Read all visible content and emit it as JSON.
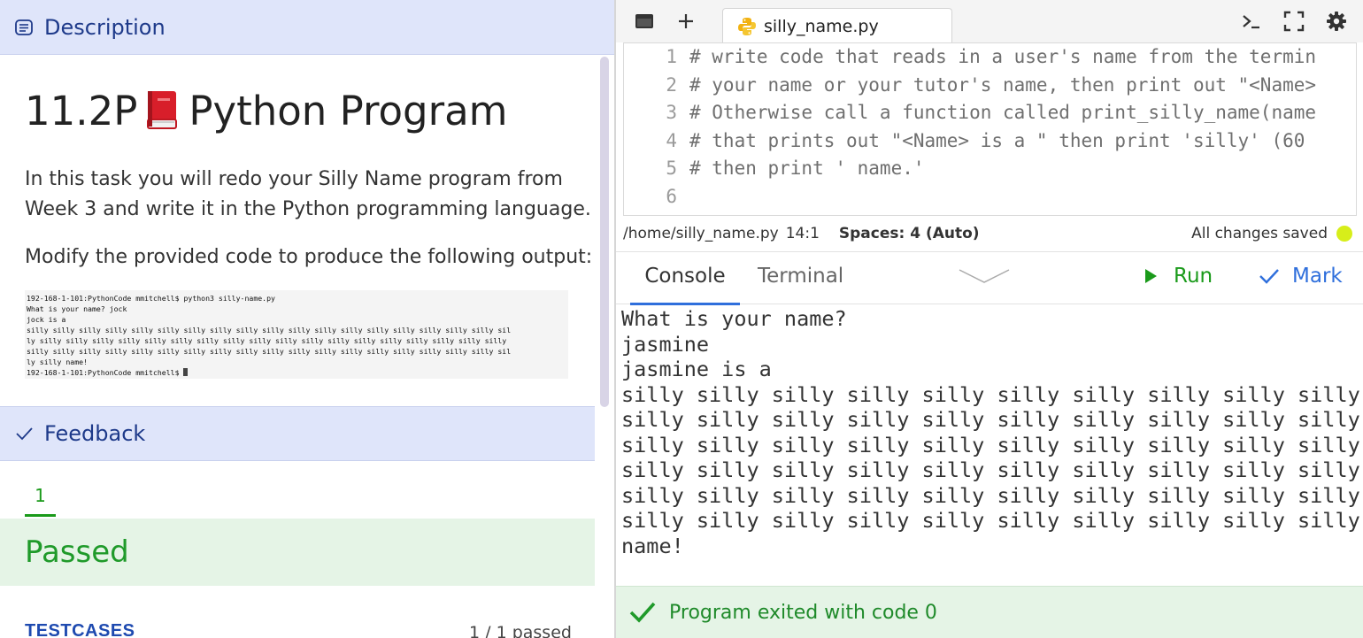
{
  "description": {
    "header": "Description",
    "title_prefix": "11.2P",
    "title_suffix": "Python Program",
    "book_icon": "red-book-emoji",
    "paragraph1": "In this task you will redo your Silly Name program from Week 3 and write it in the Python programming language.",
    "paragraph2": "Modify the provided code to produce the following output:",
    "sample_output": "192-168-1-101:PythonCode mmitchell$ python3 silly-name.py\nWhat is your name? jock\njock is a\nsilly silly silly silly silly silly silly silly silly silly silly silly silly silly silly silly silly silly sil\nly silly silly silly silly silly silly silly silly silly silly silly silly silly silly silly silly silly silly\nsilly silly silly silly silly silly silly silly silly silly silly silly silly silly silly silly silly silly sil\nly silly name!\n192-168-1-101:PythonCode mmitchell$ "
  },
  "feedback": {
    "header": "Feedback",
    "attempt_tab": "1",
    "result": "Passed",
    "testcases_label": "TESTCASES",
    "testcases_count": "1 / 1 passed"
  },
  "editor": {
    "file_tab": "silly_name.py",
    "lines": [
      {
        "n": "1",
        "text": "# write code that reads in a user's name from the termin"
      },
      {
        "n": "2",
        "text": "# your name or your tutor's name, then print out \"<Name> "
      },
      {
        "n": "3",
        "text": "# Otherwise call a function called print_silly_name(name"
      },
      {
        "n": "4",
        "text": "# that prints out \"<Name> is a \" then print 'silly' (60 "
      },
      {
        "n": "5",
        "text": "# then print ' name.'"
      },
      {
        "n": "6",
        "text": ""
      }
    ]
  },
  "statusbar": {
    "path": "/home/silly_name.py",
    "position": "14:1",
    "spaces": "Spaces: 4 (Auto)",
    "saved": "All changes saved",
    "saved_color": "#d7ee1a"
  },
  "console": {
    "tab_console": "Console",
    "tab_terminal": "Terminal",
    "run_label": "Run",
    "mark_label": "Mark",
    "output": "What is your name?\njasmine\njasmine is a\nsilly silly silly silly silly silly silly silly silly silly\nsilly silly silly silly silly silly silly silly silly silly\nsilly silly silly silly silly silly silly silly silly silly\nsilly silly silly silly silly silly silly silly silly silly\nsilly silly silly silly silly silly silly silly silly silly\nsilly silly silly silly silly silly silly silly silly silly\nname!",
    "exit_message": "Program exited with code 0"
  },
  "colors": {
    "header_bg": "#dfe5fa",
    "header_text": "#1e3a8a",
    "passed_green": "#1f9a2a",
    "accent_blue": "#2f6fdc"
  }
}
